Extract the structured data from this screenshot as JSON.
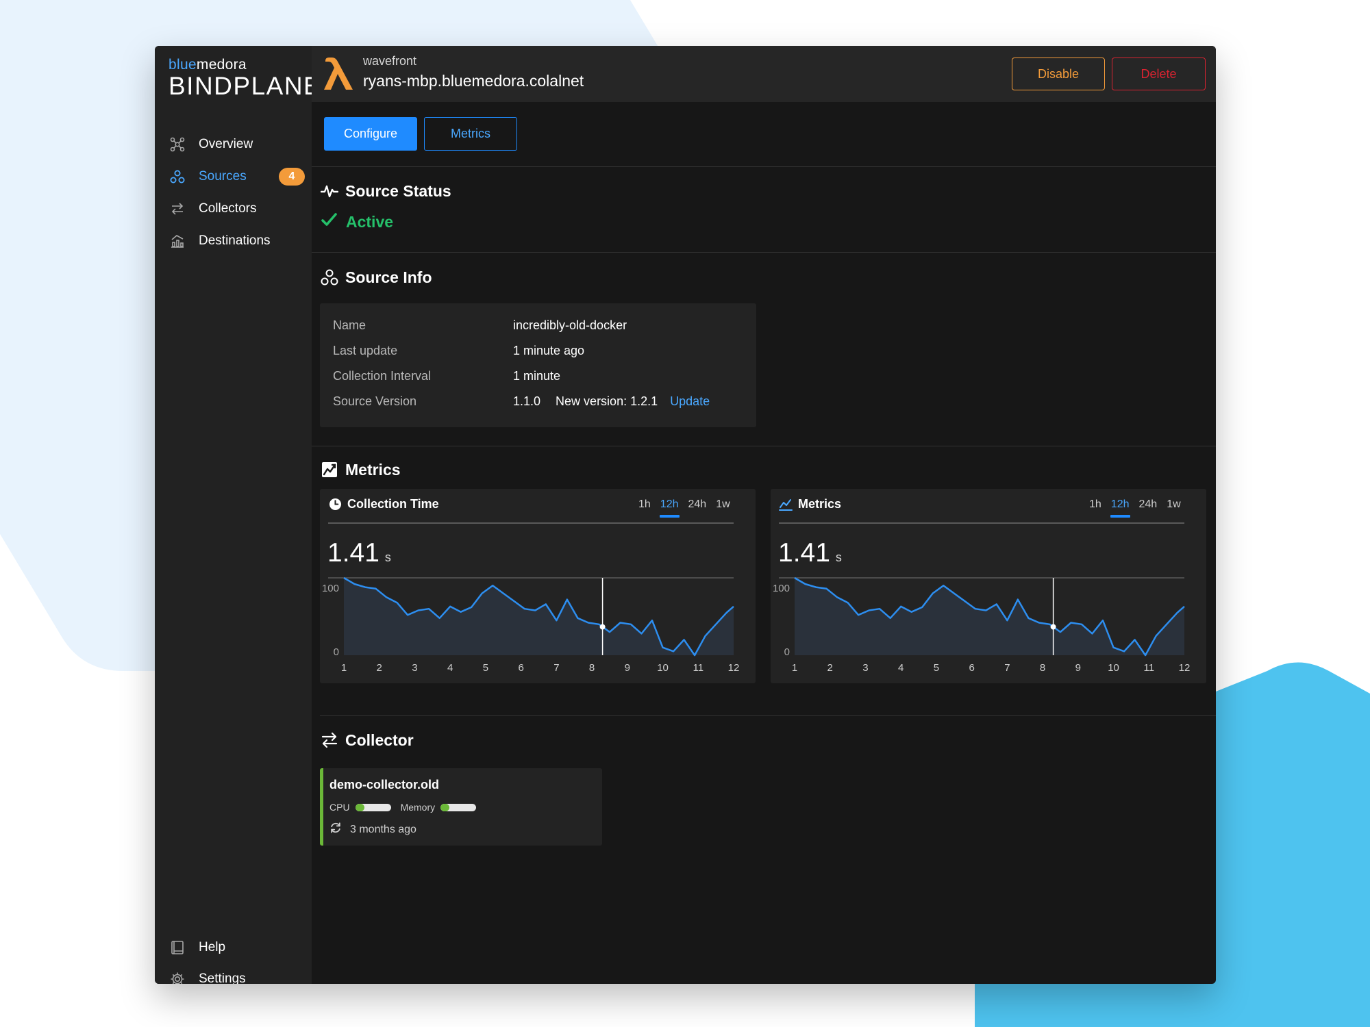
{
  "brand": {
    "company_prefix": "blue",
    "company_suffix": "medora",
    "product": "BINDPLANE"
  },
  "sidebar": {
    "items": [
      {
        "label": "Overview",
        "icon": "overview-icon"
      },
      {
        "label": "Sources",
        "icon": "sources-icon",
        "badge": "4",
        "active": true
      },
      {
        "label": "Collectors",
        "icon": "collectors-icon"
      },
      {
        "label": "Destinations",
        "icon": "destinations-icon"
      }
    ],
    "bottom": [
      {
        "label": "Help",
        "icon": "book-icon"
      },
      {
        "label": "Settings",
        "icon": "gear-icon"
      }
    ]
  },
  "header": {
    "source_type": "wavefront",
    "host": "ryans-mbp.bluemedora.colalnet",
    "disable_label": "Disable",
    "delete_label": "Delete"
  },
  "tabs": {
    "configure": "Configure",
    "metrics": "Metrics"
  },
  "status": {
    "title": "Source Status",
    "value": "Active"
  },
  "info": {
    "title": "Source Info",
    "rows": [
      {
        "label": "Name",
        "value": "incredibly-old-docker"
      },
      {
        "label": "Last update",
        "value": "1 minute ago"
      },
      {
        "label": "Collection Interval",
        "value": "1 minute"
      },
      {
        "label": "Source Version",
        "value": "1.1.0",
        "extra": "New version: 1.2.1",
        "link": "Update"
      }
    ]
  },
  "metrics_section": {
    "title": "Metrics",
    "range_options": [
      "1h",
      "12h",
      "24h",
      "1w"
    ],
    "active_range": "12h",
    "cards": [
      {
        "title": "Collection Time",
        "icon": "clock-icon",
        "value": "1.41",
        "unit": "s"
      },
      {
        "title": "Metrics",
        "icon": "line-chart-icon",
        "value": "1.41",
        "unit": "s"
      }
    ]
  },
  "chart_data": [
    {
      "type": "area",
      "title": "Collection Time",
      "x": [
        1,
        1.3,
        1.6,
        1.9,
        2.2,
        2.5,
        2.8,
        3.1,
        3.4,
        3.7,
        4.0,
        4.3,
        4.6,
        4.9,
        5.2,
        5.5,
        5.8,
        6.1,
        6.4,
        6.7,
        7.0,
        7.3,
        7.6,
        7.9,
        8.2,
        8.5,
        8.8,
        9.1,
        9.4,
        9.7,
        10.0,
        10.3,
        10.6,
        10.9,
        11.2,
        11.5,
        11.8,
        12
      ],
      "values": [
        100,
        92,
        88,
        86,
        75,
        68,
        52,
        58,
        60,
        48,
        63,
        56,
        62,
        80,
        90,
        80,
        70,
        60,
        58,
        66,
        45,
        72,
        48,
        42,
        40,
        30,
        42,
        40,
        28,
        45,
        10,
        5,
        20,
        0,
        25,
        40,
        55,
        63
      ],
      "xlabel": "",
      "ylabel": "",
      "x_ticks": [
        1,
        2,
        3,
        4,
        5,
        6,
        7,
        8,
        9,
        10,
        11,
        12
      ],
      "y_ticks": [
        0,
        100
      ],
      "xlim": [
        1,
        12
      ],
      "ylim": [
        0,
        100
      ],
      "cursor_x": 8.3,
      "grid": false
    },
    {
      "type": "area",
      "title": "Metrics",
      "x": [
        1,
        1.3,
        1.6,
        1.9,
        2.2,
        2.5,
        2.8,
        3.1,
        3.4,
        3.7,
        4.0,
        4.3,
        4.6,
        4.9,
        5.2,
        5.5,
        5.8,
        6.1,
        6.4,
        6.7,
        7.0,
        7.3,
        7.6,
        7.9,
        8.2,
        8.5,
        8.8,
        9.1,
        9.4,
        9.7,
        10.0,
        10.3,
        10.6,
        10.9,
        11.2,
        11.5,
        11.8,
        12
      ],
      "values": [
        100,
        92,
        88,
        86,
        75,
        68,
        52,
        58,
        60,
        48,
        63,
        56,
        62,
        80,
        90,
        80,
        70,
        60,
        58,
        66,
        45,
        72,
        48,
        42,
        40,
        30,
        42,
        40,
        28,
        45,
        10,
        5,
        20,
        0,
        25,
        40,
        55,
        63
      ],
      "xlabel": "",
      "ylabel": "",
      "x_ticks": [
        1,
        2,
        3,
        4,
        5,
        6,
        7,
        8,
        9,
        10,
        11,
        12
      ],
      "y_ticks": [
        0,
        100
      ],
      "xlim": [
        1,
        12
      ],
      "ylim": [
        0,
        100
      ],
      "cursor_x": 8.3,
      "grid": false
    }
  ],
  "collector": {
    "title": "Collector",
    "name": "demo-collector.old",
    "cpu_label": "CPU",
    "cpu_level": 0.25,
    "memory_label": "Memory",
    "memory_level": 0.25,
    "last_seen": "3 months ago"
  },
  "colors": {
    "accent": "#1f8bff",
    "warning": "#f39b3a",
    "danger": "#d92331",
    "success": "#25c06a",
    "collector_ok": "#6bb838",
    "chart_line": "#2d8ef0"
  }
}
